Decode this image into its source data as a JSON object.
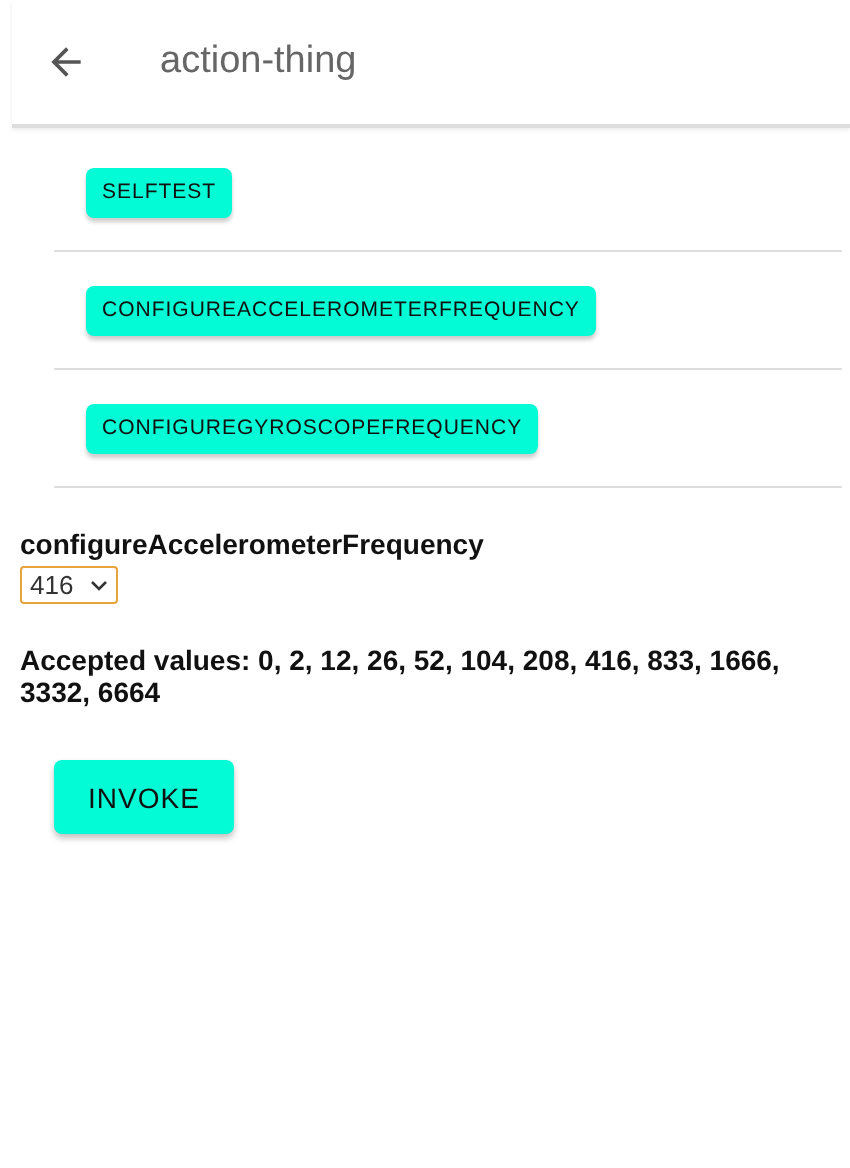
{
  "header": {
    "title": "action-thing"
  },
  "actions": [
    {
      "label": "SELFTEST"
    },
    {
      "label": "CONFIGUREACCELEROMETERFREQUENCY"
    },
    {
      "label": "CONFIGUREGYROSCOPEFREQUENCY"
    }
  ],
  "form": {
    "title": "configureAccelerometerFrequency",
    "dropdown": {
      "value": "416"
    },
    "hint": "Accepted values: 0, 2, 12, 26, 52, 104, 208, 416, 833, 1666, 3332, 6664",
    "button": "INVOKE"
  }
}
